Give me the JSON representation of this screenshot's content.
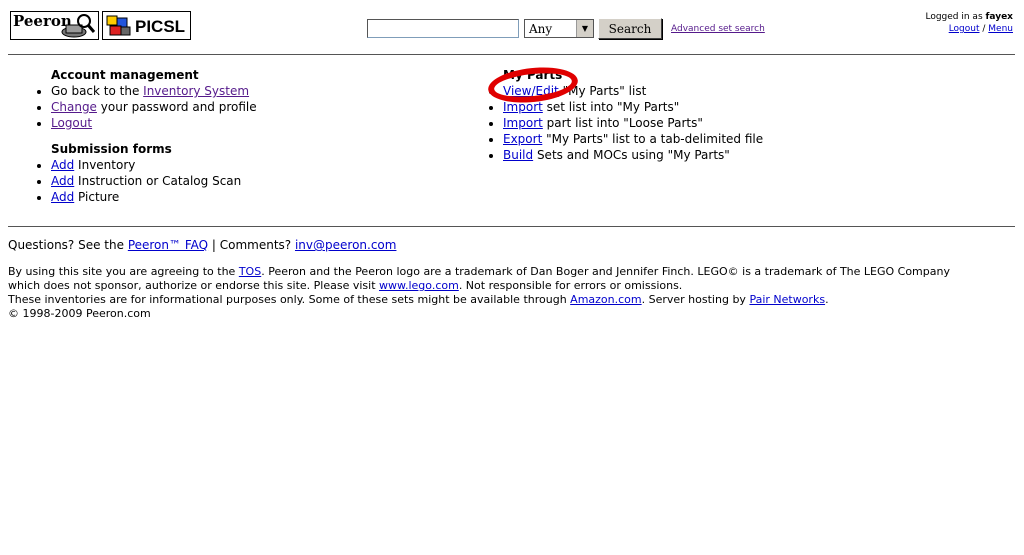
{
  "header": {
    "logo_peeron": "Peeron",
    "logo_picsl": "PICSL",
    "search": {
      "value": "",
      "placeholder": ""
    },
    "select_value": "Any",
    "search_button": "Search",
    "advanced_link": "Advanced set search",
    "login": {
      "prefix": "Logged in as ",
      "user": "fayex",
      "logout": "Logout",
      "sep": " / ",
      "menu": "Menu"
    }
  },
  "account": {
    "title": "Account management",
    "items": [
      {
        "pre": "Go back to the ",
        "link": "Inventory System",
        "post": ""
      },
      {
        "pre": "",
        "link": "Change",
        "post": " your password and profile"
      },
      {
        "pre": "",
        "link": "Logout",
        "post": ""
      }
    ]
  },
  "submission": {
    "title": "Submission forms",
    "items": [
      {
        "link": "Add",
        "post": " Inventory"
      },
      {
        "link": "Add",
        "post": " Instruction or Catalog Scan"
      },
      {
        "link": "Add",
        "post": " Picture"
      }
    ]
  },
  "myparts": {
    "title": "My Parts",
    "items": [
      {
        "link": "View/Edit",
        "post": " \"My Parts\" list"
      },
      {
        "link": "Import",
        "post": " set list into \"My Parts\""
      },
      {
        "link": "Import",
        "post": " part list into \"Loose Parts\""
      },
      {
        "link": "Export",
        "post": " \"My Parts\" list to a tab-delimited file"
      },
      {
        "link": "Build",
        "post": " Sets and MOCs using \"My Parts\""
      }
    ]
  },
  "footer": {
    "q_pre": "Questions? See the ",
    "faq": "Peeron™ FAQ",
    "q_mid": " | Comments? ",
    "email": "inv@peeron.com",
    "l1_pre": "By using this site you are agreeing to the ",
    "tos": "TOS",
    "l1_post": ". Peeron and the Peeron logo are a trademark of Dan Boger and Jennifer Finch. LEGO© is a trademark of The LEGO Company",
    "l2_pre": "which does not sponsor, authorize or endorse this site.  Please visit ",
    "lego": "www.lego.com",
    "l2_post": ".   Not responsible for errors or omissions.",
    "l3_pre": "These inventories are for informational purposes only.  Some of these sets might be available through ",
    "amazon": "Amazon.com",
    "l3_mid": ". Server hosting by ",
    "pair": "Pair Networks",
    "l3_post": ".",
    "copyright": "© 1998-2009 Peeron.com"
  },
  "colors": {
    "link": "#0000cc",
    "visited": "#551a8b",
    "highlight": "#e00000"
  }
}
